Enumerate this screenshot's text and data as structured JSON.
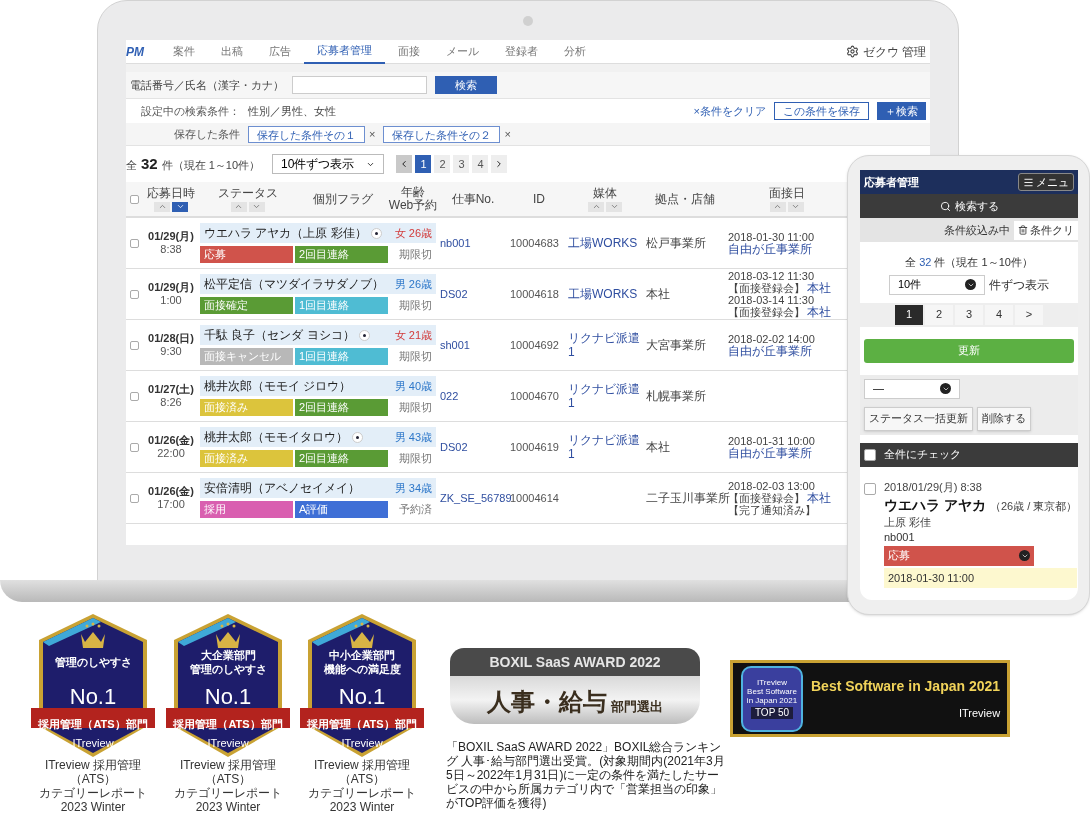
{
  "laptop": {
    "nav": {
      "logo": "PM",
      "items": [
        {
          "label": "案件",
          "selected": false
        },
        {
          "label": "出稿",
          "selected": false
        },
        {
          "label": "広告",
          "selected": false
        },
        {
          "label": "応募者管理",
          "selected": true
        },
        {
          "label": "面接",
          "selected": false
        },
        {
          "label": "メール",
          "selected": false
        },
        {
          "label": "登録者",
          "selected": false
        },
        {
          "label": "分析",
          "selected": false
        }
      ],
      "user": "ゼクウ 管理"
    },
    "search": {
      "label": "電話番号／氏名（漢字・カナ）",
      "button": "検索"
    },
    "conditions": {
      "label": "設定中の検索条件：",
      "value": "性別／男性、女性",
      "clear": "×条件をクリア",
      "save": "この条件を保存",
      "more": "＋検索"
    },
    "saved": {
      "label": "保存した条件",
      "chips": [
        {
          "label": "保存した条件その１",
          "remove": "×"
        },
        {
          "label": "保存した条件その２",
          "remove": "×"
        }
      ]
    },
    "summary": {
      "prefix": "全",
      "count": "32",
      "suffix": "件（現在 1～10件）",
      "per_page": "10件ずつ表示",
      "pages": [
        {
          "label": "1",
          "selected": true
        },
        {
          "label": "2",
          "selected": false
        },
        {
          "label": "3",
          "selected": false
        },
        {
          "label": "4",
          "selected": false
        }
      ]
    },
    "select_all": {
      "checked": false
    },
    "columns": [
      {
        "label": "応募日時",
        "sortable": true,
        "descending": true
      },
      {
        "label": "ステータス",
        "sortable": true,
        "descending": false
      },
      {
        "label": "個別フラグ"
      },
      {
        "label": "年齢",
        "sublabel": "Web予約"
      },
      {
        "label": "仕事No."
      },
      {
        "label": "ID"
      },
      {
        "label": "媒体",
        "sortable": true,
        "descending": false
      },
      {
        "label": "拠点・店舗"
      },
      {
        "label": "面接日",
        "sortable": true,
        "descending": false
      }
    ],
    "rows": [
      {
        "checked": false,
        "date": "01/29(月)",
        "time": "8:38",
        "name": "ウエハラ アヤカ（上原 彩佳）",
        "flag": true,
        "kind": "female",
        "age": "女 26歳",
        "tags": [
          {
            "label": "応募",
            "color": "#d0534b"
          },
          {
            "label": "2回目連絡",
            "color": "#5a9b35"
          }
        ],
        "web": "期限切",
        "job": "nb001",
        "id": "10004683",
        "media": "工場WORKS",
        "location": "松戸事業所",
        "interview": [
          {
            "text": "2018-01-30 11:00"
          },
          {
            "link": "自由が丘事業所"
          }
        ]
      },
      {
        "checked": false,
        "date": "01/29(月)",
        "time": "1:00",
        "name": "松平定信（マツダイラサダノブ）",
        "flag": false,
        "kind": "male",
        "age": "男 26歳",
        "tags": [
          {
            "label": "面接確定",
            "color": "#5a9b35"
          },
          {
            "label": "1回目連絡",
            "color": "#4fbcd3"
          }
        ],
        "web": "期限切",
        "job": "DS02",
        "id": "10004618",
        "media": "工場WORKS",
        "location": "本社",
        "interview": [
          {
            "text": "2018-03-12 11:30"
          },
          {
            "text": "【面接登録会】",
            "link": "本社"
          },
          {
            "text": "2018-03-14 11:30"
          },
          {
            "text": "【面接登録会】",
            "link": "本社"
          }
        ]
      },
      {
        "checked": false,
        "date": "01/28(日)",
        "time": "9:30",
        "name": "千駄 良子（センダ ヨシコ）",
        "flag": true,
        "kind": "female",
        "age": "女 21歳",
        "tags": [
          {
            "label": "面接キャンセル",
            "color": "#b8b8b8"
          },
          {
            "label": "1回目連絡",
            "color": "#4fbcd3"
          }
        ],
        "web": "期限切",
        "job": "sh001",
        "id": "10004692",
        "media": "リクナビ派遣1",
        "location": "大宮事業所",
        "interview": [
          {
            "text": "2018-02-02 14:00"
          },
          {
            "link": "自由が丘事業所"
          }
        ]
      },
      {
        "checked": false,
        "date": "01/27(土)",
        "time": "8:26",
        "name": "桃井次郎（モモイ ジロウ）",
        "flag": false,
        "kind": "male",
        "age": "男 40歳",
        "tags": [
          {
            "label": "面接済み",
            "color": "#dcc43c"
          },
          {
            "label": "2回目連絡",
            "color": "#5a9b35"
          }
        ],
        "web": "期限切",
        "job": "022",
        "id": "10004670",
        "media": "リクナビ派遣1",
        "location": "札幌事業所",
        "interview": []
      },
      {
        "checked": false,
        "date": "01/26(金)",
        "time": "22:00",
        "name": "桃井太郎（モモイタロウ）",
        "flag": true,
        "kind": "male",
        "age": "男 43歳",
        "tags": [
          {
            "label": "面接済み",
            "color": "#dcc43c"
          },
          {
            "label": "2回目連絡",
            "color": "#5a9b35"
          }
        ],
        "web": "期限切",
        "job": "DS02",
        "id": "10004619",
        "media": "リクナビ派遣1",
        "location": "本社",
        "interview": [
          {
            "text": "2018-01-31 10:00"
          },
          {
            "link": "自由が丘事業所"
          }
        ]
      },
      {
        "checked": false,
        "date": "01/26(金)",
        "time": "17:00",
        "name": "安倍清明（アベノセイメイ）",
        "flag": false,
        "kind": "male",
        "age": "男 34歳",
        "tags": [
          {
            "label": "採用",
            "color": "#d95fb0"
          },
          {
            "label": "A評価",
            "color": "#3f6fd6"
          }
        ],
        "web": "予約済",
        "job": "ZK_SE_56789",
        "id": "10004614",
        "location": "二子玉川事業所",
        "interview": [
          {
            "text": "2018-02-03 13:00"
          },
          {
            "text": "【面接登録会】",
            "link": "本社"
          },
          {
            "text": "【完了通知済み】"
          }
        ]
      }
    ]
  },
  "phone": {
    "title": "応募者管理",
    "menu": "メニュ",
    "search": "検索する",
    "filter": "条件絞込み中",
    "clear": "条件クリ",
    "summary": {
      "prefix": "全",
      "count": "32",
      "suffix": "件（現在 1～10件）"
    },
    "per_page": "10件",
    "per_page_suffix": "件ずつ表示",
    "pages": [
      {
        "label": "1",
        "selected": true
      },
      {
        "label": "2",
        "selected": false
      },
      {
        "label": "3",
        "selected": false
      },
      {
        "label": "4",
        "selected": false
      },
      {
        "label": ">",
        "selected": false
      }
    ],
    "update": "更新",
    "bulk_select": "—",
    "bulk_buttons": [
      "ステータス一括更新",
      "削除する"
    ],
    "check_all": {
      "label": "全件にチェック",
      "checked": false
    },
    "entry": {
      "checked": false,
      "datetime": "2018/01/29(月) 8:38",
      "name": "ウエハラ アヤカ",
      "details": "（26歳 / 東京都）",
      "kanji": "上原 彩佳",
      "job": "nb001",
      "status": {
        "label": "応募",
        "color": "#d0534b"
      },
      "interview": "2018-01-30 11:00"
    }
  },
  "badges": [
    {
      "lines": [
        "管理のしやすさ"
      ],
      "rank": "No.1",
      "ribbon": "採用管理（ATS）部門",
      "brand": "ITreview",
      "caption": [
        "ITreview 採用管理（ATS）",
        "カテゴリーレポート 2023 Winter"
      ]
    },
    {
      "lines": [
        "大企業部門",
        "管理のしやすさ"
      ],
      "rank": "No.1",
      "ribbon": "採用管理（ATS）部門",
      "brand": "ITreview",
      "caption": [
        "ITreview 採用管理（ATS）",
        "カテゴリーレポート 2023 Winter"
      ]
    },
    {
      "lines": [
        "中小企業部門",
        "機能への満足度"
      ],
      "rank": "No.1",
      "ribbon": "採用管理（ATS）部門",
      "brand": "ITreview",
      "caption": [
        "ITreview 採用管理（ATS）",
        "カテゴリーレポート 2023 Winter"
      ]
    }
  ],
  "boxil": {
    "award": "BOXIL SaaS AWARD 2022",
    "category": "人事・給与",
    "suffix": "部門選出",
    "note": "「BOXIL SaaS AWARD 2022」BOXIL総合ランキング 人事･給与部門選出受賞。(対象期間内(2021年3月5日～2022年1月31日)に一定の条件を満たしたサービスの中から所属カテゴリ内で「営業担当の印象」がTOP評価を獲得)"
  },
  "itreview_banner": {
    "badge_brand": "ITreview",
    "badge_title": "Best Software in Japan 2021",
    "badge_rank": "TOP 50",
    "headline": "Best Software in Japan 2021",
    "brand": "ITreview"
  }
}
